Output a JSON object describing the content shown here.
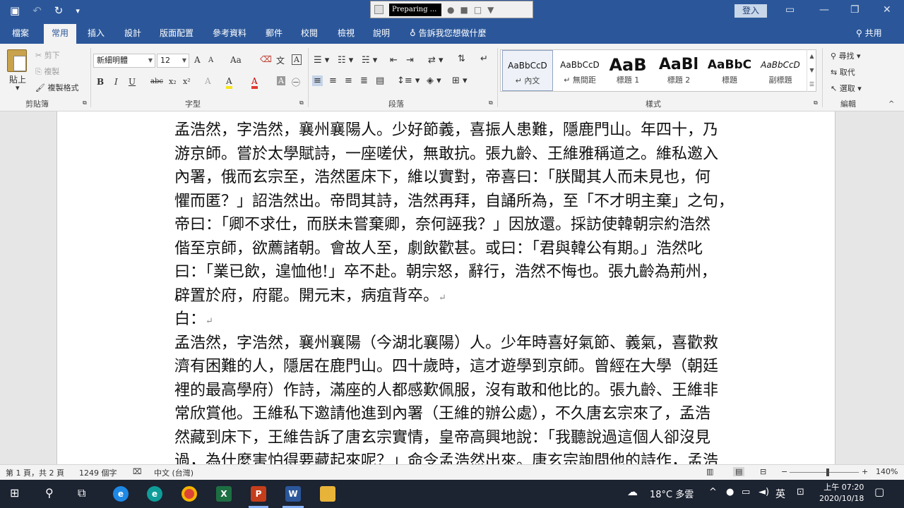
{
  "titlebar": {
    "recorder_status": "Preparing ...",
    "login": "登入",
    "icons": [
      "save-icon",
      "undo-icon",
      "redo-icon",
      "customize-icon"
    ]
  },
  "tabs": [
    "檔案",
    "常用",
    "插入",
    "設計",
    "版面配置",
    "參考資料",
    "郵件",
    "校閱",
    "檢視",
    "說明"
  ],
  "active_tab": "常用",
  "tellme": "告訴我您想做什麼",
  "share": "共用",
  "clipboard": {
    "paste": "貼上",
    "cut": "剪下",
    "copy": "複製",
    "format_painter": "複製格式",
    "label": "剪貼簿"
  },
  "font": {
    "name": "新細明體",
    "size": "12",
    "label": "字型",
    "grow": "A",
    "shrink": "A",
    "case": "Aa",
    "bold": "B",
    "italic": "I",
    "underline": "U",
    "strike": "abc",
    "sub": "x₂",
    "sup": "x²",
    "color_a": "A",
    "highlight_a": "A",
    "char_shade": "A"
  },
  "paragraph": {
    "label": "段落"
  },
  "styles": {
    "label": "樣式",
    "items": [
      {
        "sample": "AaBbCcD",
        "name": "↵ 內文"
      },
      {
        "sample": "AaBbCcD",
        "name": "↵ 無間距"
      },
      {
        "sample": "AaB",
        "name": "標題 1"
      },
      {
        "sample": "AaBl",
        "name": "標題 2"
      },
      {
        "sample": "AaBbC",
        "name": "標題"
      },
      {
        "sample": "AaBbCcD",
        "name": "副標題"
      }
    ]
  },
  "editing": {
    "label": "編輯",
    "find": "尋找",
    "replace": "取代",
    "select": "選取"
  },
  "document": {
    "lines": [
      "孟浩然，字浩然，襄州襄陽人。少好節義，喜振人患難，隱鹿門山。年四十，乃",
      "游京師。嘗於太學賦詩，一座嗟伏，無敢抗。張九齡、王維雅稱道之。維私邀入",
      "內署，俄而玄宗至，浩然匿床下，維以實對，帝喜曰：「朕聞其人而未見也，何",
      "懼而匿？」詔浩然出。帝問其詩，浩然再拜，自誦所為，至「不才明主棄」之句，",
      "帝曰：「卿不求仕，而朕未嘗棄卿，奈何誣我？」因放還。採訪使韓朝宗約浩然",
      "偕至京師，欲薦諸朝。會故人至，劇飲歡甚。或曰：「君與韓公有期。」浩然叱",
      "曰：「業已飲，遑恤他!」卒不赴。朝宗怒，辭行，浩然不悔也。張九齡為荊州，",
      "辟置於府，府罷。開元末，病疽背卒。",
      "白：",
      "孟浩然，字浩然，襄州襄陽（今湖北襄陽）人。少年時喜好氣節、義氣，喜歡救",
      "濟有困難的人，隱居在鹿門山。四十歲時，這才遊學到京師。曾經在大學（朝廷",
      "裡的最高學府）作詩，滿座的人都感歎佩服，沒有敢和他比的。張九齡、王維非",
      "常欣賞他。王維私下邀請他進到內署（王維的辦公處），不久唐玄宗來了，孟浩",
      "然藏到床下，王維告訴了唐玄宗實情，皇帝高興地說：「我聽說過這個人卻沒見",
      "過，為什麼害怕得要藏起來呢？」命令孟浩然出來。唐玄宗詢問他的詩作，孟浩"
    ]
  },
  "statusbar": {
    "page": "第 1 頁，共 2 頁",
    "words": "1249 個字",
    "language": "中文 (台灣)",
    "zoom": "140%",
    "minus": "−",
    "plus": "+"
  },
  "taskbar": {
    "weather": "18°C  多雲",
    "ime": "英",
    "time": "上午 07:20",
    "date": "2020/10/18"
  }
}
